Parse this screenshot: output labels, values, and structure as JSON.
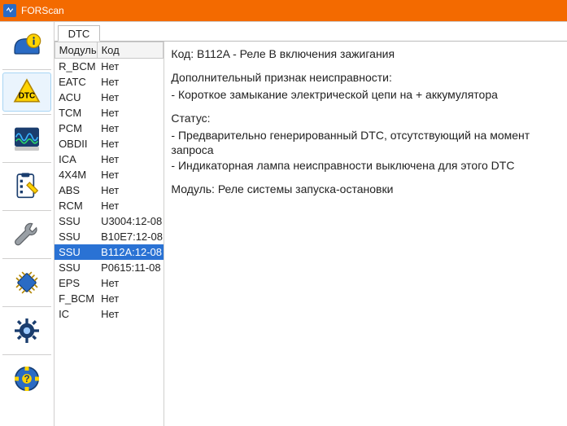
{
  "app": {
    "title": "FORScan"
  },
  "tabs": {
    "active": "DTC"
  },
  "table": {
    "headers": {
      "module": "Модуль",
      "code": "Код"
    },
    "rows": [
      {
        "module": "R_BCM",
        "code": "Нет",
        "selected": false
      },
      {
        "module": "EATC",
        "code": "Нет",
        "selected": false
      },
      {
        "module": "ACU",
        "code": "Нет",
        "selected": false
      },
      {
        "module": "TCM",
        "code": "Нет",
        "selected": false
      },
      {
        "module": "PCM",
        "code": "Нет",
        "selected": false
      },
      {
        "module": "OBDII",
        "code": "Нет",
        "selected": false
      },
      {
        "module": "ICA",
        "code": "Нет",
        "selected": false
      },
      {
        "module": "4X4M",
        "code": "Нет",
        "selected": false
      },
      {
        "module": "ABS",
        "code": "Нет",
        "selected": false
      },
      {
        "module": "RCM",
        "code": "Нет",
        "selected": false
      },
      {
        "module": "SSU",
        "code": "U3004:12-08",
        "selected": false
      },
      {
        "module": "SSU",
        "code": "B10E7:12-08",
        "selected": false
      },
      {
        "module": "SSU",
        "code": "B112A:12-08",
        "selected": true
      },
      {
        "module": "SSU",
        "code": "P0615:11-08",
        "selected": false
      },
      {
        "module": "EPS",
        "code": "Нет",
        "selected": false
      },
      {
        "module": "F_BCM",
        "code": "Нет",
        "selected": false
      },
      {
        "module": "IC",
        "code": "Нет",
        "selected": false
      }
    ]
  },
  "details": {
    "line_code": "Код: B112A - Реле B включения зажигания",
    "diag_header": "Дополнительный признак неисправности:",
    "diag_item1": " - Короткое замыкание электрической цепи на + аккумулятора",
    "status_header": "Статус:",
    "status_item1": " - Предварительно генерированный DTC, отсутствующий на момент запроса",
    "status_item2": " - Индикаторная лампа неисправности выключена для этого DTC",
    "module_line": "Модуль: Реле системы запуска-остановки"
  },
  "sidebar": {
    "items": [
      {
        "name": "vehicle-info",
        "selected": false
      },
      {
        "name": "dtc",
        "selected": true
      },
      {
        "name": "oscilloscope",
        "selected": false
      },
      {
        "name": "tests",
        "selected": false
      },
      {
        "name": "service",
        "selected": false
      },
      {
        "name": "chip",
        "selected": false
      },
      {
        "name": "settings",
        "selected": false
      },
      {
        "name": "help",
        "selected": false
      }
    ]
  }
}
